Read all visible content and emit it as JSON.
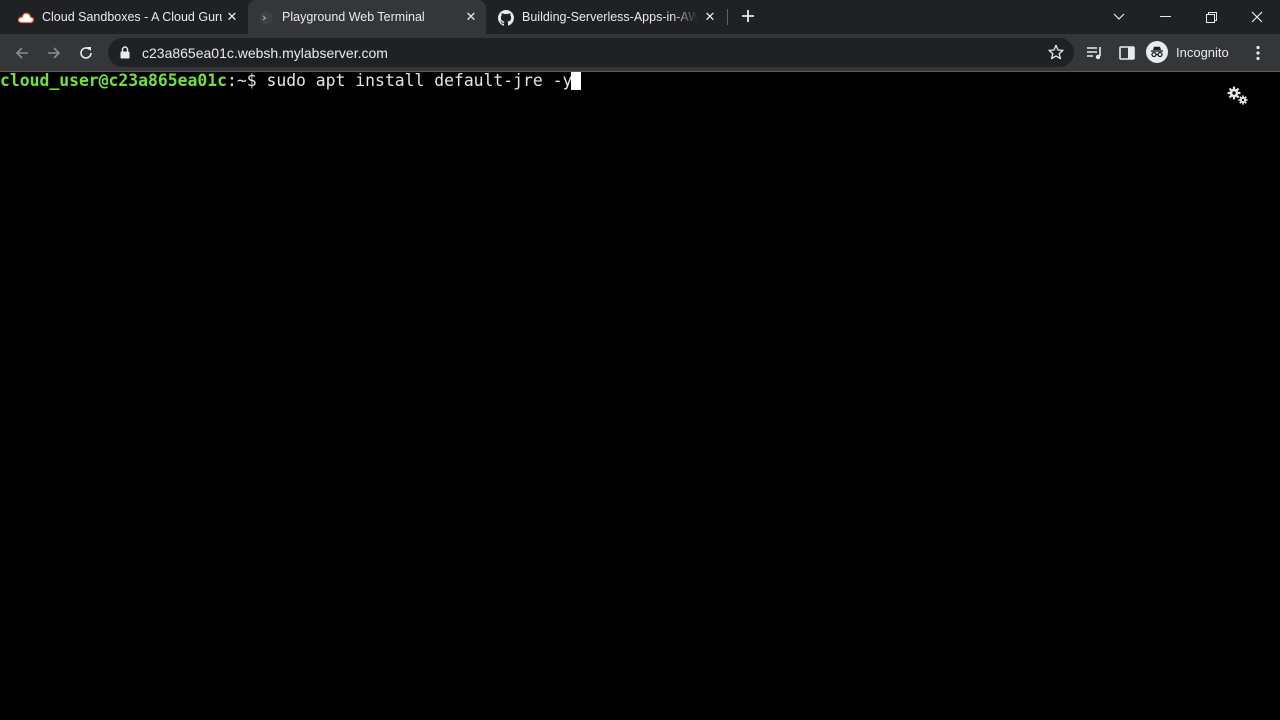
{
  "browser": {
    "tabs": [
      {
        "label": "Cloud Sandboxes - A Cloud Guru",
        "favicon": "cloud-icon",
        "active": false
      },
      {
        "label": "Playground Web Terminal",
        "favicon": "terminal-favicon",
        "active": true
      },
      {
        "label": "Building-Serverless-Apps-in-AWS",
        "favicon": "github-icon",
        "active": false
      }
    ],
    "url": "c23a865ea01c.websh.mylabserver.com",
    "profile_label": "Incognito"
  },
  "terminal": {
    "prompt_user": "cloud_user@c23a865ea01c",
    "prompt_suffix": ":~$ ",
    "command": "sudo apt install default-jre -y",
    "colors": {
      "prompt": "#6fe33b",
      "text": "#e5e5e5",
      "background": "#000000"
    }
  }
}
